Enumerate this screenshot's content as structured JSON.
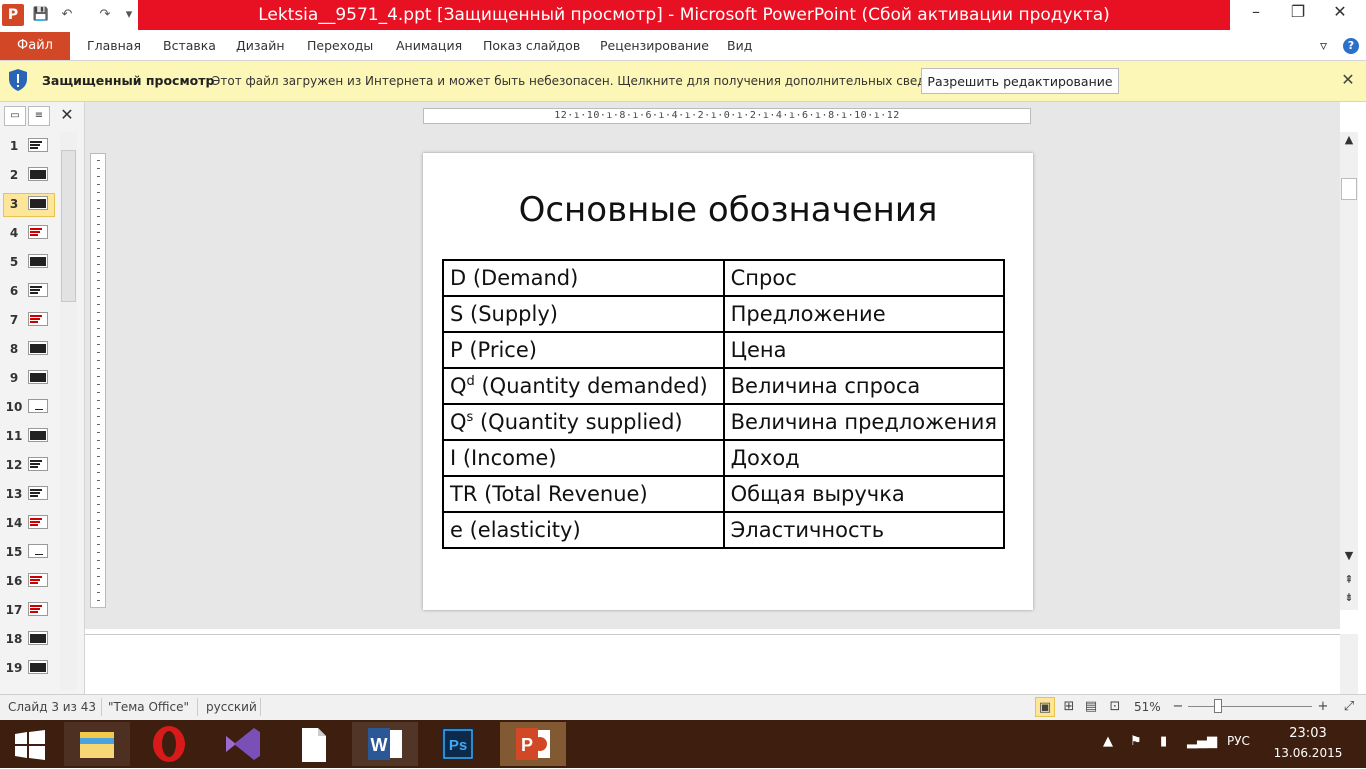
{
  "window": {
    "title": "Lektsia__9571_4.ppt [Защищенный просмотр]  -  Microsoft PowerPoint (Сбой активации продукта)",
    "app_icon_letter": "P",
    "minimize": "–",
    "restore": "❐",
    "close": "✕"
  },
  "quick_access": {
    "save": "💾",
    "undo": "↶",
    "redo": "↷",
    "customize": "▾"
  },
  "ribbon": {
    "file": "Файл",
    "tabs": [
      "Главная",
      "Вставка",
      "Дизайн",
      "Переходы",
      "Анимация",
      "Показ слайдов",
      "Рецензирование",
      "Вид"
    ],
    "collapse": "▿",
    "help": "?"
  },
  "protected_view": {
    "title": "Защищенный просмотр",
    "message": "Этот файл загружен из Интернета и может быть небезопасен. Щелкните для получения дополнительных сведений.",
    "enable_button": "Разрешить редактирование",
    "close": "✕"
  },
  "left_panel": {
    "close": "✕",
    "thumbnails": [
      "1",
      "2",
      "3",
      "4",
      "5",
      "6",
      "7",
      "8",
      "9",
      "10",
      "11",
      "12",
      "13",
      "14",
      "15",
      "16",
      "17",
      "18",
      "19"
    ],
    "selected": 3
  },
  "ruler": {
    "horizontal": "12·ı·10·ı·8·ı·6·ı·4·ı·2·ı·0·ı·2·ı·4·ı·6·ı·8·ı·10·ı·12"
  },
  "slide": {
    "title": "Основные обозначения",
    "rows": [
      {
        "term": "D (Demand)",
        "sup": "",
        "term_rest": "",
        "meaning": "Спрос"
      },
      {
        "term": "S (Supply)",
        "sup": "",
        "term_rest": "",
        "meaning": "Предложение"
      },
      {
        "term": "P (Price)",
        "sup": "",
        "term_rest": "",
        "meaning": "Цена"
      },
      {
        "term": "Q",
        "sup": "d",
        "term_rest": " (Quantity demanded)",
        "meaning": "Величина спроса"
      },
      {
        "term": "Q",
        "sup": "s",
        "term_rest": " (Quantity supplied)",
        "meaning": "Величина предложения"
      },
      {
        "term": "I (Income)",
        "sup": "",
        "term_rest": "",
        "meaning": "Доход"
      },
      {
        "term": "TR (Total Revenue)",
        "sup": "",
        "term_rest": "",
        "meaning": "Общая выручка"
      },
      {
        "term": "e (elasticity)",
        "sup": "",
        "term_rest": "",
        "meaning": "Эластичность"
      }
    ]
  },
  "status_bar": {
    "slide_info": "Слайд 3 из 43",
    "theme": "\"Тема Office\"",
    "language": "русский",
    "zoom": "51%",
    "zoom_minus": "−",
    "zoom_plus": "+"
  },
  "taskbar": {
    "language": "РУС",
    "time": "23:03",
    "date": "13.06.2015"
  },
  "colors": {
    "powerpoint_accent": "#d24726",
    "title_bar_error": "#e81123",
    "protected_bar": "#fcf7b6",
    "taskbar": "#3e1f0f"
  }
}
